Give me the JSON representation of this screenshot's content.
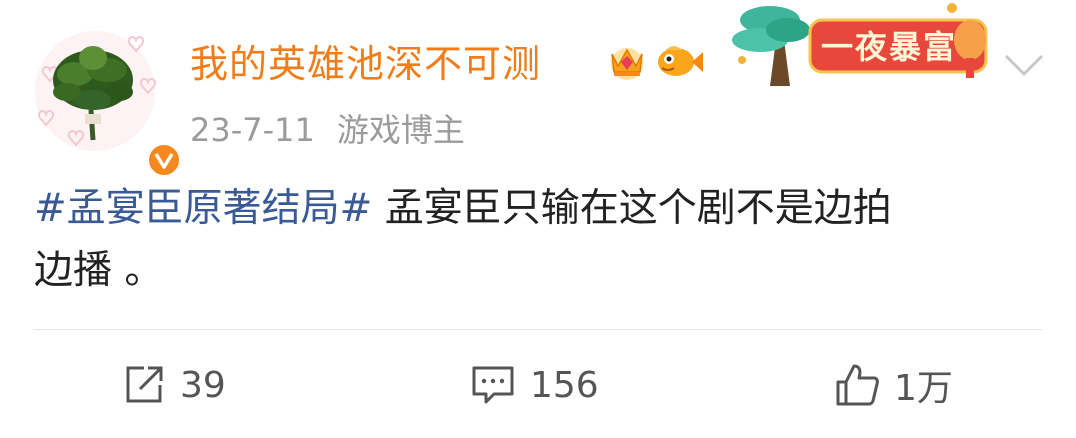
{
  "post": {
    "username": "我的英雄池深不可测",
    "date": "23-7-11",
    "source": "游戏博主",
    "topic": "#孟宴臣原著结局#",
    "body_line1": " 孟宴臣只输在这个剧不是边拍",
    "body_line2": "边播 。"
  },
  "promo": {
    "label": "一夜暴富"
  },
  "actions": {
    "repost_count": "39",
    "comment_count": "156",
    "like_count": "1万"
  },
  "icons": {
    "verified": "verified-v-icon",
    "crown": "crown-icon",
    "fish": "fish-icon",
    "chevron": "chevron-down-icon",
    "repost": "repost-icon",
    "comment": "comment-icon",
    "like": "thumbs-up-icon"
  },
  "colors": {
    "username": "#f07c1a",
    "topic": "#3a5a96",
    "verified": "#f5891e",
    "meta": "#9b9b9b"
  }
}
